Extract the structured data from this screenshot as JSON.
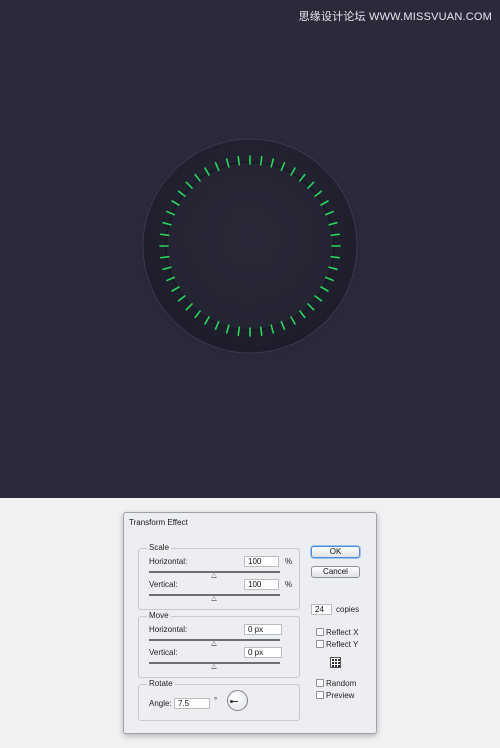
{
  "watermark": "思缘设计论坛 WWW.MISSVUAN.COM",
  "artwork": {
    "background_color": "#2b2a3a",
    "dial_color": "#232232",
    "tick_color": "#27d85a",
    "tick_count": 48
  },
  "dialog": {
    "title": "Transform Effect",
    "scale": {
      "legend": "Scale",
      "horizontal_label": "Horizontal:",
      "horizontal_value": "100",
      "horizontal_unit": "%",
      "vertical_label": "Vertical:",
      "vertical_value": "100",
      "vertical_unit": "%"
    },
    "move": {
      "legend": "Move",
      "horizontal_label": "Horizontal:",
      "horizontal_value": "0 px",
      "vertical_label": "Vertical:",
      "vertical_value": "0 px"
    },
    "rotate": {
      "legend": "Rotate",
      "angle_label": "Angle:",
      "angle_value": "7.5",
      "angle_unit": "°"
    },
    "ok_label": "OK",
    "cancel_label": "Cancel",
    "copies_value": "24",
    "copies_label": "copies",
    "reflect_x_label": "Reflect X",
    "reflect_y_label": "Reflect Y",
    "random_label": "Random",
    "preview_label": "Preview"
  }
}
